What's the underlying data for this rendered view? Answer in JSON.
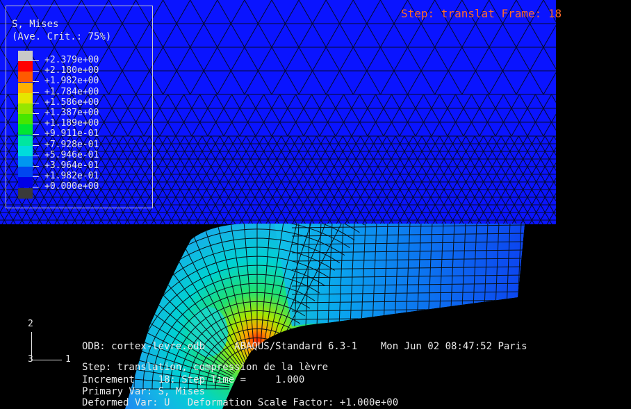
{
  "header": {
    "step_frame": "Step: translat Frame: 18"
  },
  "legend": {
    "variable": "S, Mises",
    "averaging": "(Ave. Crit.: 75%)",
    "levels": [
      {
        "label": "+2.379e+00",
        "color": "#c8c8c8"
      },
      {
        "label": "+2.180e+00",
        "color": "#ff0000"
      },
      {
        "label": "+1.982e+00",
        "color": "#ff5a00"
      },
      {
        "label": "+1.784e+00",
        "color": "#ffb000"
      },
      {
        "label": "+1.586e+00",
        "color": "#e6e600"
      },
      {
        "label": "+1.387e+00",
        "color": "#96e600"
      },
      {
        "label": "+1.189e+00",
        "color": "#46e600"
      },
      {
        "label": "+9.911e-01",
        "color": "#00e632"
      },
      {
        "label": "+7.928e-01",
        "color": "#00e6a0"
      },
      {
        "label": "+5.946e-01",
        "color": "#00dcdc"
      },
      {
        "label": "+3.964e-01",
        "color": "#0096f0"
      },
      {
        "label": "+1.982e-01",
        "color": "#0046f0"
      },
      {
        "label": "+0.000e+00",
        "color": "#0000e6"
      }
    ],
    "below_range_color": "#3a3a3a"
  },
  "triad": {
    "axis_vertical": "2",
    "axis_horizontal": "1",
    "axis_out": "3"
  },
  "info": {
    "line1": "ODB: cortex-levre.odb     ABAQUS/Standard 6.3-1    Mon Jun 02 08:47:52 Paris",
    "line2": "Step: translation, compression de la lèvre",
    "line3": "Increment    18: Step Time =     1.000",
    "line4": "Primary Var: S, Mises",
    "line5": "Deformed Var: U   Deformation Scale Factor: +1.000e+00"
  },
  "colors": {
    "background": "#000000",
    "plate": "#0a14ff",
    "mesh_line": "#0a0a14"
  }
}
